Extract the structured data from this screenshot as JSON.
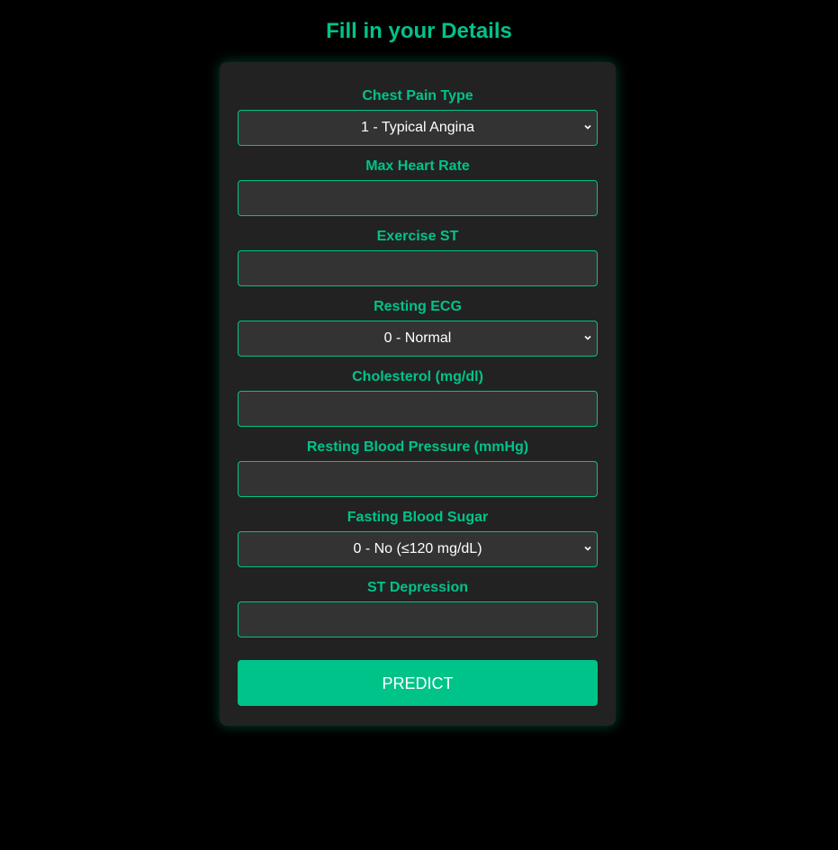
{
  "title": "Fill in your Details",
  "accent_color": "#00c389",
  "fields": [
    {
      "label": "Chest Pain Type",
      "type": "select",
      "value": "1 - Typical Angina"
    },
    {
      "label": "Max Heart Rate",
      "type": "input",
      "value": ""
    },
    {
      "label": "Exercise ST",
      "type": "input",
      "value": ""
    },
    {
      "label": "Resting ECG",
      "type": "select",
      "value": "0 - Normal"
    },
    {
      "label": "Cholesterol (mg/dl)",
      "type": "input",
      "value": ""
    },
    {
      "label": "Resting Blood Pressure (mmHg)",
      "type": "input",
      "value": ""
    },
    {
      "label": "Fasting Blood Sugar",
      "type": "select",
      "value": "0 - No (≤120 mg/dL)"
    },
    {
      "label": "ST Depression",
      "type": "input",
      "value": ""
    }
  ],
  "submit_label": "PREDICT",
  "icons": {
    "select_indicator": "chevron-down-icon"
  }
}
